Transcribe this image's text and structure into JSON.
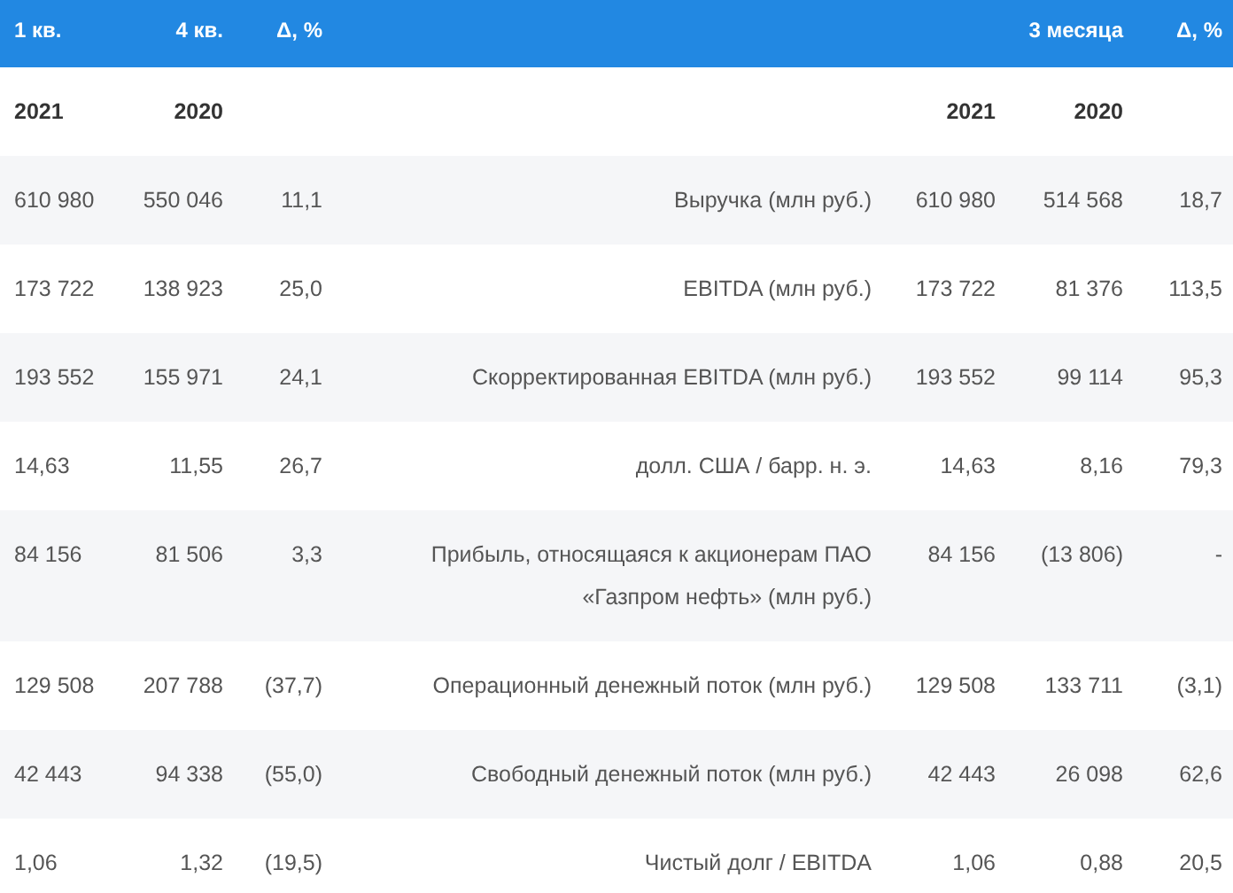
{
  "header": {
    "column_1": "1 кв.",
    "column_2": "4 кв.",
    "column_3": "Δ, %",
    "column_6": "3 месяца",
    "column_7": "Δ, %"
  },
  "years": {
    "column_1": "2021",
    "column_2": "2020",
    "column_5": "2021",
    "column_6": "2020"
  },
  "rows": [
    {
      "q1_2021": "610 980",
      "q4_2020": "550 046",
      "change_q": "11,1",
      "metric": "Выручка (млн руб.)",
      "m3_2021": "610 980",
      "m3_2020": "514 568",
      "change_m3": "18,7"
    },
    {
      "q1_2021": "173 722",
      "q4_2020": "138 923",
      "change_q": "25,0",
      "metric": "EBITDA (млн руб.)",
      "m3_2021": "173 722",
      "m3_2020": "81 376",
      "change_m3": "113,5"
    },
    {
      "q1_2021": "193 552",
      "q4_2020": "155 971",
      "change_q": "24,1",
      "metric": "Скорректированная EBITDA (млн руб.)",
      "m3_2021": "193 552",
      "m3_2020": "99 114",
      "change_m3": "95,3"
    },
    {
      "q1_2021": "14,63",
      "q4_2020": "11,55",
      "change_q": "26,7",
      "metric": "долл. США / барр. н. э.",
      "m3_2021": "14,63",
      "m3_2020": "8,16",
      "change_m3": "79,3"
    },
    {
      "q1_2021": "84 156",
      "q4_2020": "81 506",
      "change_q": "3,3",
      "metric": "Прибыль, относящаяся к акционерам ПАО «Газпром нефть» (млн руб.)",
      "m3_2021": "84 156",
      "m3_2020": "(13 806)",
      "change_m3": "-"
    },
    {
      "q1_2021": "129 508",
      "q4_2020": "207 788",
      "change_q": "(37,7)",
      "metric": "Операционный денежный поток (млн руб.)",
      "m3_2021": "129 508",
      "m3_2020": "133 711",
      "change_m3": "(3,1)"
    },
    {
      "q1_2021": "42 443",
      "q4_2020": "94 338",
      "change_q": "(55,0)",
      "metric": "Свободный денежный поток (млн руб.)",
      "m3_2021": "42 443",
      "m3_2020": "26 098",
      "change_m3": "62,6"
    },
    {
      "q1_2021": "1,06",
      "q4_2020": "1,32",
      "change_q": "(19,5)",
      "metric": "Чистый долг / EBITDA",
      "m3_2021": "1,06",
      "m3_2020": "0,88",
      "change_m3": "20,5"
    }
  ]
}
